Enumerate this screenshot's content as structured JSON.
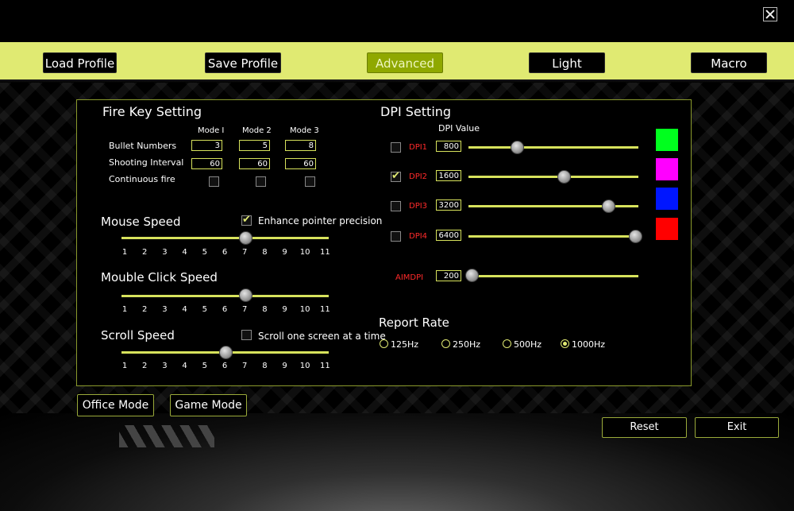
{
  "nav": {
    "load_profile": "Load Profile",
    "save_profile": "Save Profile",
    "advanced": "Advanced",
    "light": "Light",
    "macro": "Macro"
  },
  "fire_key": {
    "title": "Fire Key Setting",
    "modes": [
      "Mode I",
      "Mode 2",
      "Mode 3"
    ],
    "bullet_label": "Bullet Numbers",
    "bullet_values": [
      "3",
      "5",
      "8"
    ],
    "interval_label": "Shooting Interval",
    "interval_values": [
      "60",
      "60",
      "60"
    ],
    "continuous_label": "Continuous fire"
  },
  "mouse_speed": {
    "title": "Mouse Speed",
    "precision_label": "Enhance pointer precision",
    "precision_checked": true,
    "value": 7
  },
  "double_click": {
    "title": "Mouble Click Speed",
    "value": 7
  },
  "scroll": {
    "title": "Scroll Speed",
    "one_screen_label": "Scroll one screen at a time",
    "one_screen_checked": false,
    "value": 6
  },
  "ticks": [
    "1",
    "2",
    "3",
    "4",
    "5",
    "6",
    "7",
    "8",
    "9",
    "10",
    "11"
  ],
  "dpi": {
    "title": "DPI Setting",
    "value_header": "DPI Value",
    "levels": [
      {
        "label": "DPI1",
        "value": "800",
        "checked": false,
        "color": "#00ff1e",
        "pos": 0.29
      },
      {
        "label": "DPI2",
        "value": "1600",
        "checked": true,
        "color": "#ff00ff",
        "pos": 0.57
      },
      {
        "label": "DPI3",
        "value": "3200",
        "checked": false,
        "color": "#0016ff",
        "pos": 0.84
      },
      {
        "label": "DPI4",
        "value": "6400",
        "checked": false,
        "color": "#ff0000",
        "pos": 1.0
      }
    ],
    "aim_label": "AIMDPI",
    "aim_value": "200"
  },
  "report_rate": {
    "title": "Report Rate",
    "options": [
      "125Hz",
      "250Hz",
      "500Hz",
      "1000Hz"
    ],
    "selected": "1000Hz"
  },
  "modes": {
    "office": "Office Mode",
    "game": "Game Mode"
  },
  "footer": {
    "reset": "Reset",
    "exit": "Exit"
  },
  "colors": {
    "accent": "#e0ea72",
    "active_tab": "#8fa800"
  }
}
